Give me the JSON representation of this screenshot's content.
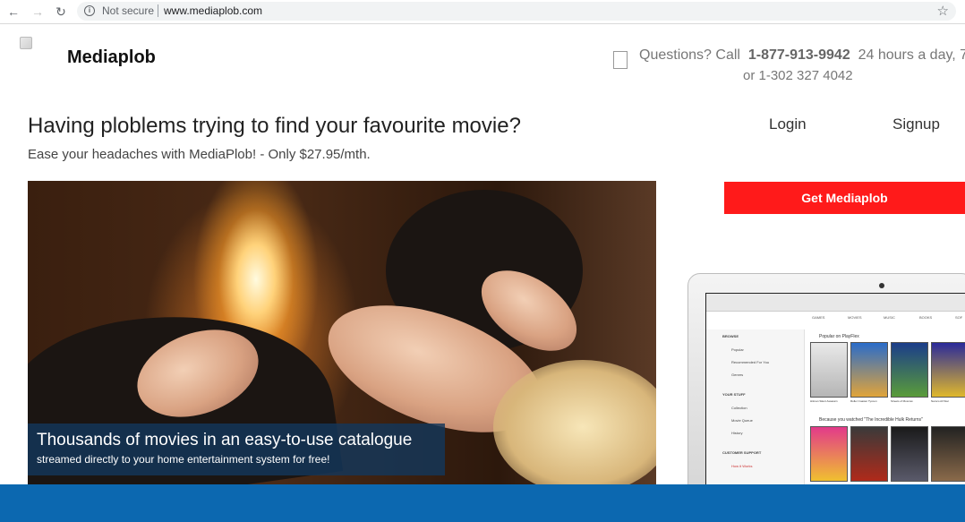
{
  "browser": {
    "security_label": "Not secure",
    "url": "www.mediaplob.com"
  },
  "header": {
    "brand": "Mediaplob",
    "contact_prefix": "Questions? Call",
    "contact_phone": "1-877-913-9942",
    "contact_suffix": "24 hours a day, 7",
    "contact_alt": "or 1-302 327 4042"
  },
  "hero": {
    "headline": "Having ploblems trying to find your favourite movie?",
    "subline": "Ease your headaches with MediaPlob! - Only $27.95/mth.",
    "caption_title": "Thousands of movies in an easy-to-use catalogue",
    "caption_sub": "streamed directly to your home entertainment system for free!"
  },
  "auth": {
    "login": "Login",
    "signup": "Signup"
  },
  "cta": {
    "label": "Get Mediaplob"
  },
  "screen": {
    "tabs": [
      "GAMES",
      "MOVIES",
      "MUSIC",
      "BOOKS",
      "SOF"
    ],
    "browse_heading": "BROWSE",
    "browse_items": [
      "Popular",
      "Recommended For You",
      "Genres"
    ],
    "stuff_heading": "YOUR STUFF",
    "stuff_items": [
      "Collection",
      "Movie Queue",
      "History"
    ],
    "support_heading": "CUSTOMER SUPPORT",
    "support_items": [
      "How it Works"
    ],
    "row1_title": "Popular on PlayFlex",
    "row2_title": "Because you watched \"The Incredible Hulk Returns\"",
    "row1_tiles": [
      "Hitman Silent Assassin",
      "Roller Coaster Tycoon",
      "Streets of Moscow",
      "Namco All Star"
    ]
  }
}
